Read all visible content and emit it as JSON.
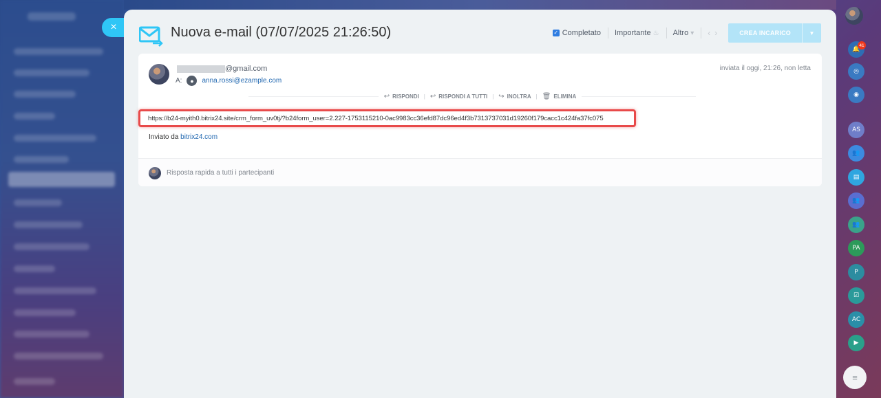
{
  "window": {
    "title": "Nuova e-mail (07/07/2025 21:26:50)",
    "close_glyph": "×"
  },
  "toolbar": {
    "completed_label": "Completato",
    "completed_checked": true,
    "important_label": "Importante",
    "more_label": "Altro",
    "create_task_label": "CREA INCARICO"
  },
  "email": {
    "sender_domain": "@gmail.com",
    "to_label": "A:",
    "to_address": "anna.rossi@ezample.com",
    "sent_info": "inviata il oggi, 21:26, non letta",
    "actions": {
      "reply": "RISPONDI",
      "reply_all": "RISPONDI A TUTTI",
      "forward": "INOLTRA",
      "delete": "ELIMINA"
    },
    "body_link": "https://b24-myith0.bitrix24.site/crm_form_uv0tj/?b24form_user=2.227-1753115210-0ac9983cc36efd87dc96ed4f3b7313737031d19260f179cacc1c424fa37fc075",
    "sent_by_prefix": "Inviato da",
    "sent_by_link": "bitrix24.com",
    "quick_reply_placeholder": "Risposta rapida a tutti i partecipanti"
  },
  "right_rail": {
    "notification_count": "41",
    "avatars": [
      "AS",
      "PA",
      "P",
      "AC"
    ]
  },
  "colors": {
    "accent": "#2fc6f6",
    "highlight_border": "#e84a4a",
    "link": "#2067b0"
  }
}
